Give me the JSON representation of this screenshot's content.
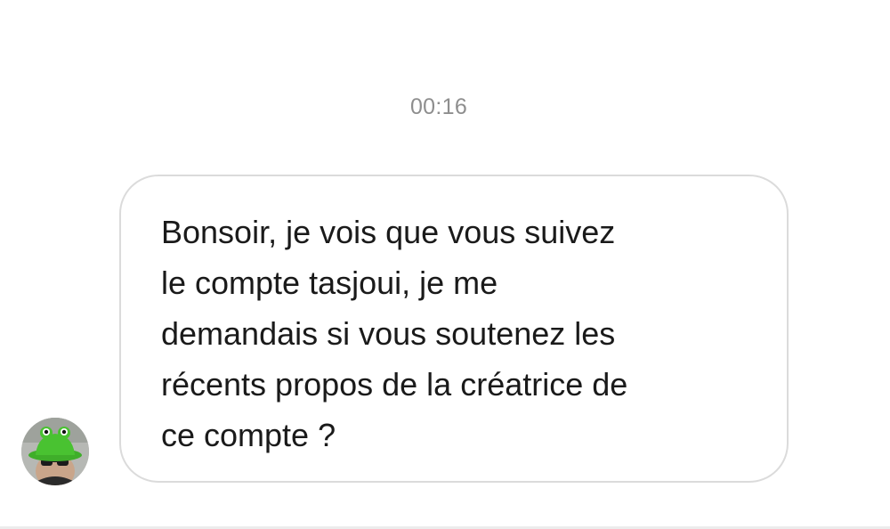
{
  "thread": {
    "timestamp": "00:16"
  },
  "message": {
    "sender_avatar_icon": "frog-bucket-hat-avatar-icon",
    "text": "Bonsoir, je vois que vous suivez\nle compte tasjoui, je me\ndemandais si vous soutenez les\nrécents propos de la créatrice de\nce compte ?"
  },
  "colors": {
    "timestamp": "#8e8e8e",
    "bubble_border": "#dbdbdb",
    "text": "#1a1a1a",
    "background": "#ffffff"
  }
}
